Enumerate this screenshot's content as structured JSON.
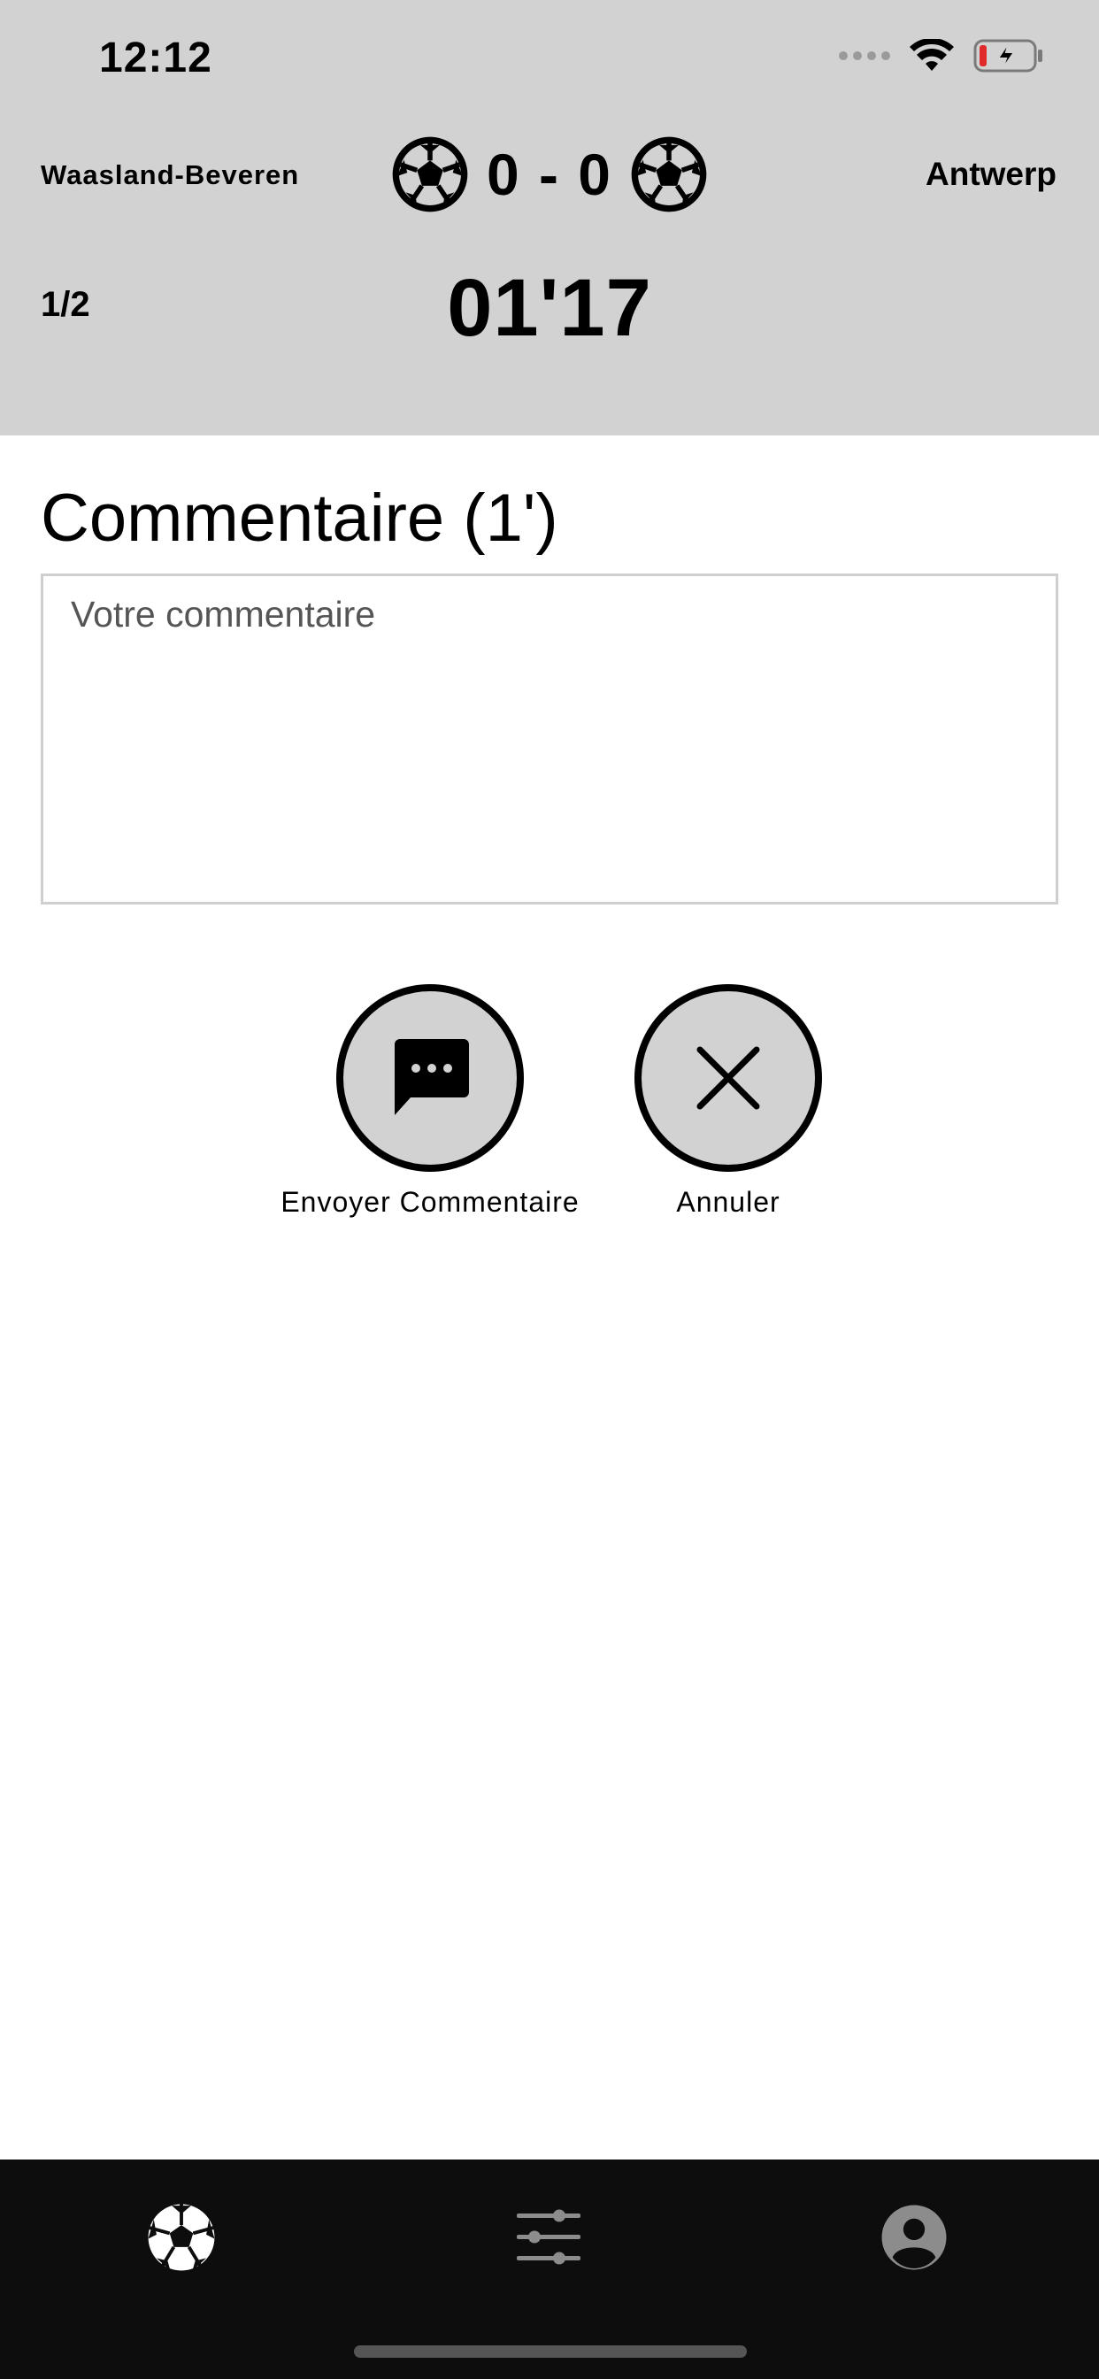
{
  "status_bar": {
    "time": "12:12"
  },
  "match": {
    "home_team": "Waasland-Beveren",
    "away_team": "Antwerp",
    "score": "0 - 0",
    "period": "1/2",
    "clock": "01'17"
  },
  "comment": {
    "title": "Commentaire (1')",
    "placeholder": "Votre commentaire",
    "value": ""
  },
  "actions": {
    "send_label": "Envoyer Commentaire",
    "cancel_label": "Annuler"
  },
  "tabbar": {
    "items": [
      {
        "icon": "soccer-ball-icon",
        "active": true
      },
      {
        "icon": "sliders-icon",
        "active": false
      },
      {
        "icon": "account-icon",
        "active": false
      }
    ]
  },
  "colors": {
    "header_bg": "#d2d2d2",
    "tabbar_bg": "#0d0d0d",
    "button_fill": "#d2d2d2"
  }
}
